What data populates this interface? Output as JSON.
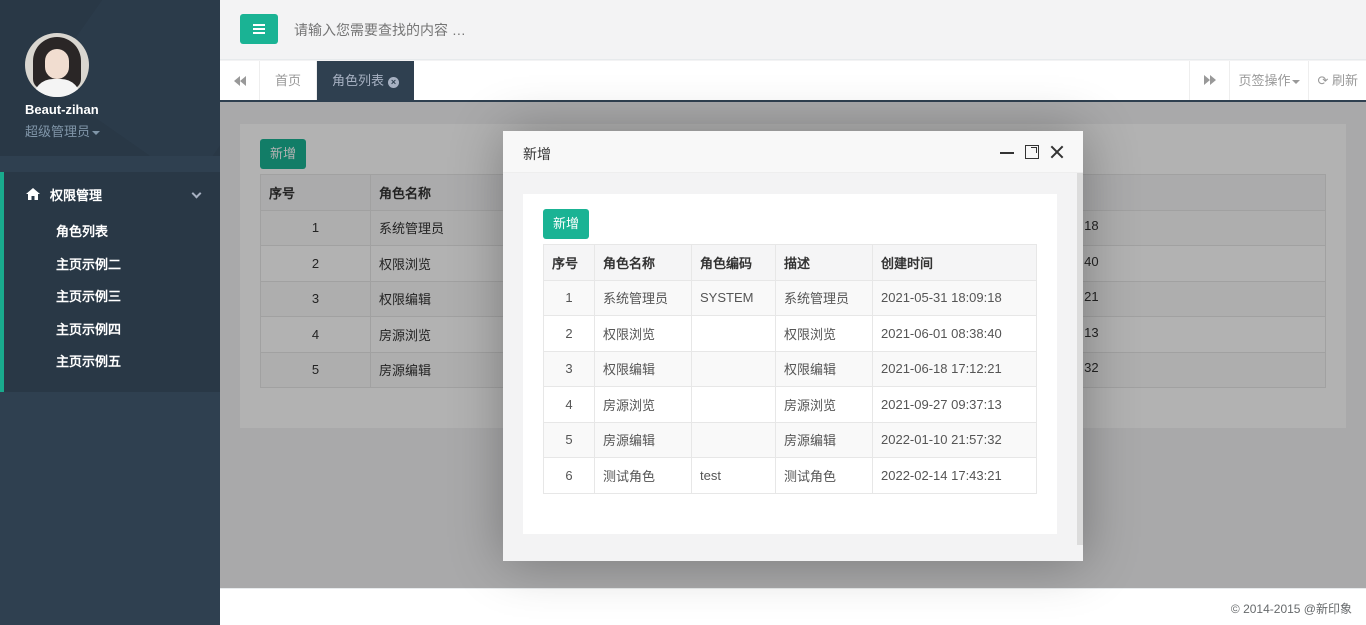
{
  "profile": {
    "name": "Beaut-zihan",
    "role": "超级管理员"
  },
  "sidebar": {
    "group_label": "权限管理",
    "items": [
      {
        "label": "角色列表"
      },
      {
        "label": "主页示例二"
      },
      {
        "label": "主页示例三"
      },
      {
        "label": "主页示例四"
      },
      {
        "label": "主页示例五"
      }
    ]
  },
  "topbar": {
    "search_placeholder": "请输入您需要查找的内容 …"
  },
  "tabs": {
    "home": "首页",
    "active": "角色列表",
    "page_ops": "页签操作",
    "refresh": "刷新"
  },
  "background_page": {
    "add_label": "新增",
    "headers": [
      "序号",
      "角色名称"
    ],
    "rows": [
      {
        "no": "1",
        "name": "系统管理员",
        "time_tail": ":18"
      },
      {
        "no": "2",
        "name": "权限浏览",
        "time_tail": ":40"
      },
      {
        "no": "3",
        "name": "权限编辑",
        "time_tail": ":21"
      },
      {
        "no": "4",
        "name": "房源浏览",
        "time_tail": ":13"
      },
      {
        "no": "5",
        "name": "房源编辑",
        "time_tail": ":32"
      }
    ]
  },
  "modal": {
    "title": "新增",
    "add_label": "新增",
    "headers": [
      "序号",
      "角色名称",
      "角色编码",
      "描述",
      "创建时间"
    ],
    "rows": [
      {
        "no": "1",
        "name": "系统管理员",
        "code": "SYSTEM",
        "desc": "系统管理员",
        "created": "2021-05-31 18:09:18"
      },
      {
        "no": "2",
        "name": "权限浏览",
        "code": "",
        "desc": "权限浏览",
        "created": "2021-06-01 08:38:40"
      },
      {
        "no": "3",
        "name": "权限编辑",
        "code": "",
        "desc": "权限编辑",
        "created": "2021-06-18 17:12:21"
      },
      {
        "no": "4",
        "name": "房源浏览",
        "code": "",
        "desc": "房源浏览",
        "created": "2021-09-27 09:37:13"
      },
      {
        "no": "5",
        "name": "房源编辑",
        "code": "",
        "desc": "房源编辑",
        "created": "2022-01-10 21:57:32"
      },
      {
        "no": "6",
        "name": "测试角色",
        "code": "test",
        "desc": "测试角色",
        "created": "2022-02-14 17:43:21"
      }
    ]
  },
  "footer": {
    "text": "© 2014-2015 @新印象"
  },
  "colors": {
    "accent": "#1ab394",
    "sidebar": "#2f4050"
  }
}
